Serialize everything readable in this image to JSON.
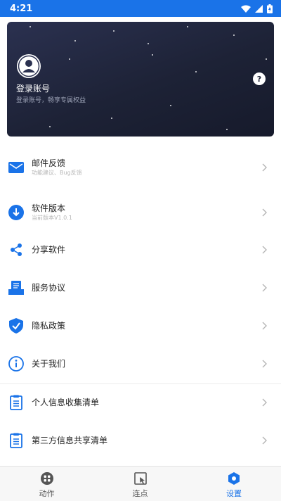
{
  "status_bar": {
    "time": "4:21"
  },
  "profile": {
    "title": "登录账号",
    "subtitle": "登录账号，畅享专属权益",
    "help": "?"
  },
  "menu": {
    "items": [
      {
        "label": "邮件反馈",
        "sub": "功能建议、Bug反馈",
        "icon": "mail-icon"
      },
      {
        "label": "软件版本",
        "sub": "当前版本V1.0.1",
        "icon": "download-icon"
      },
      {
        "label": "分享软件",
        "sub": "",
        "icon": "share-icon"
      },
      {
        "label": "服务协议",
        "sub": "",
        "icon": "agreement-icon"
      },
      {
        "label": "隐私政策",
        "sub": "",
        "icon": "shield-check-icon"
      },
      {
        "label": "关于我们",
        "sub": "",
        "icon": "info-icon"
      },
      {
        "label": "个人信息收集清单",
        "sub": "",
        "icon": "clipboard-list-icon"
      },
      {
        "label": "第三方信息共享清单",
        "sub": "",
        "icon": "clipboard-list-icon"
      }
    ]
  },
  "bottom_nav": {
    "tabs": [
      {
        "label": "动作",
        "icon": "grid-icon",
        "active": false
      },
      {
        "label": "连点",
        "icon": "cursor-icon",
        "active": false
      },
      {
        "label": "设置",
        "icon": "settings-hexagon-icon",
        "active": true
      }
    ]
  },
  "colors": {
    "accent": "#1a73e8",
    "card_bg": "#1d2236"
  }
}
